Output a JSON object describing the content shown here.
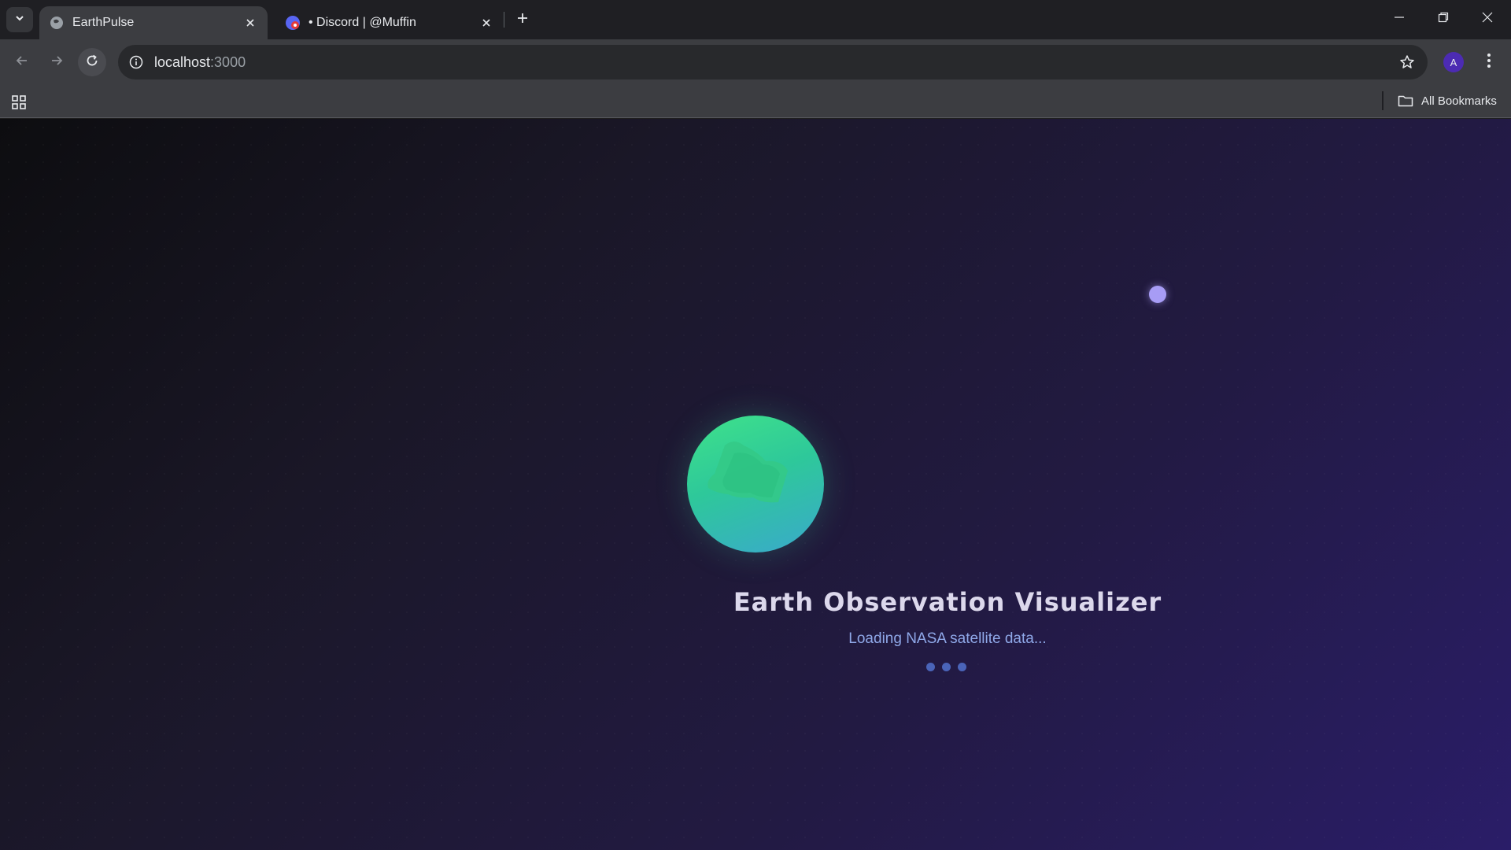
{
  "browser": {
    "tabs": [
      {
        "title": "EarthPulse",
        "active": true
      },
      {
        "title": "• Discord | @Muffin",
        "active": false
      }
    ],
    "address": {
      "host": "localhost",
      "port": ":3000"
    },
    "profile_initial": "A",
    "bookmarks_label": "All Bookmarks"
  },
  "loading_screen": {
    "title": "Earth Observation Visualizer",
    "subtitle": "Loading NASA satellite data...",
    "loader_dots": 3
  },
  "colors": {
    "background_start": "#0d0d10",
    "background_end": "#2a1d68",
    "globe_green": "#3fe28a",
    "globe_blue": "#3aa9cc",
    "orb": "#a79cf5",
    "subtitle": "#8fa8e8"
  }
}
